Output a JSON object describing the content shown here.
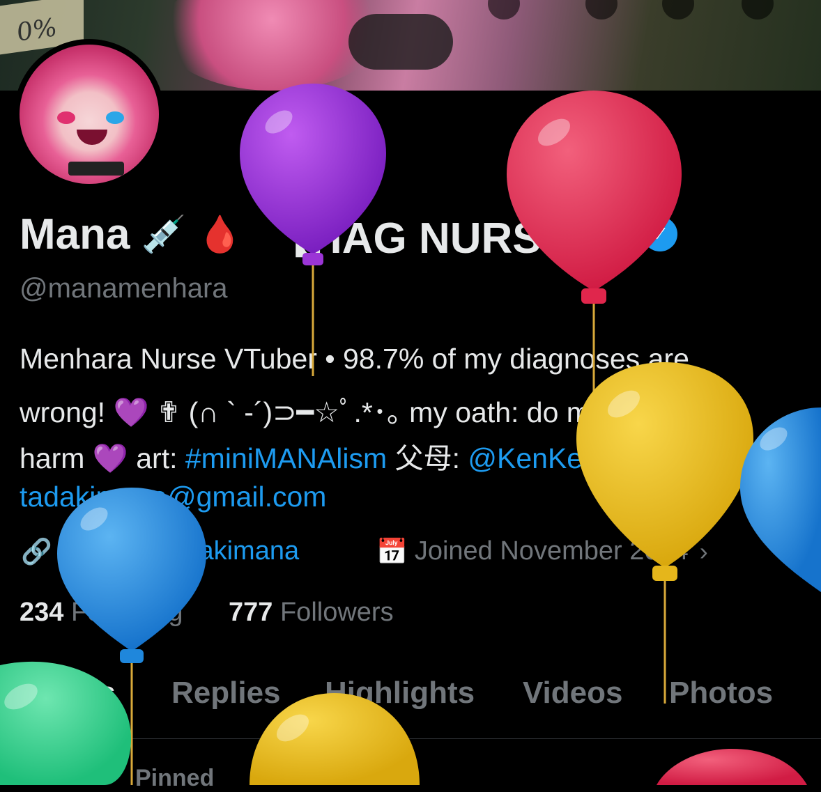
{
  "banner": {
    "sign_text": "0%"
  },
  "profile": {
    "display_name": "Mana",
    "name_emojis": [
      "💉",
      "🩸"
    ],
    "name_tag": "【HAG NURSE】",
    "verified_icon": "verified-badge-icon",
    "handle": "@manamenhara",
    "bio_line1": "Menhara Nurse VTuber • 98.7% of my diagnoses are",
    "bio_line2": "wrong! 💜 ✟ (∩ ` -´)⊃━☆ﾟ.*･｡ my oath: do more",
    "bio_line3_text1": "harm 💜 art: ",
    "bio_hashtag": "#miniMANAlism",
    "bio_line3_text2": " 父母: ",
    "bio_mention": "@KenKenMo6",
    "bio_line3_text3": "✟",
    "bio_email": "tadakimana@gmail.com",
    "website": "twitch.tv/tadakimana",
    "joined": "Joined November 2024",
    "following_count": "234",
    "following_label": "Following",
    "followers_count": "777",
    "followers_label": "Followers"
  },
  "tabs": [
    {
      "label": "Posts",
      "active": true
    },
    {
      "label": "Replies",
      "active": false
    },
    {
      "label": "Highlights",
      "active": false
    },
    {
      "label": "Videos",
      "active": false
    },
    {
      "label": "Photos",
      "active": false
    }
  ],
  "pinned_label": "Pinned",
  "colors": {
    "accent": "#1d9bf0",
    "text_primary": "#e7e9ea",
    "text_secondary": "#71767b",
    "background": "#000000",
    "balloon_purple": "#8e2bd1",
    "balloon_red": "#e0264c",
    "balloon_yellow": "#e5b61b",
    "balloon_blue": "#1f87dc",
    "balloon_green": "#2ecf8a"
  }
}
